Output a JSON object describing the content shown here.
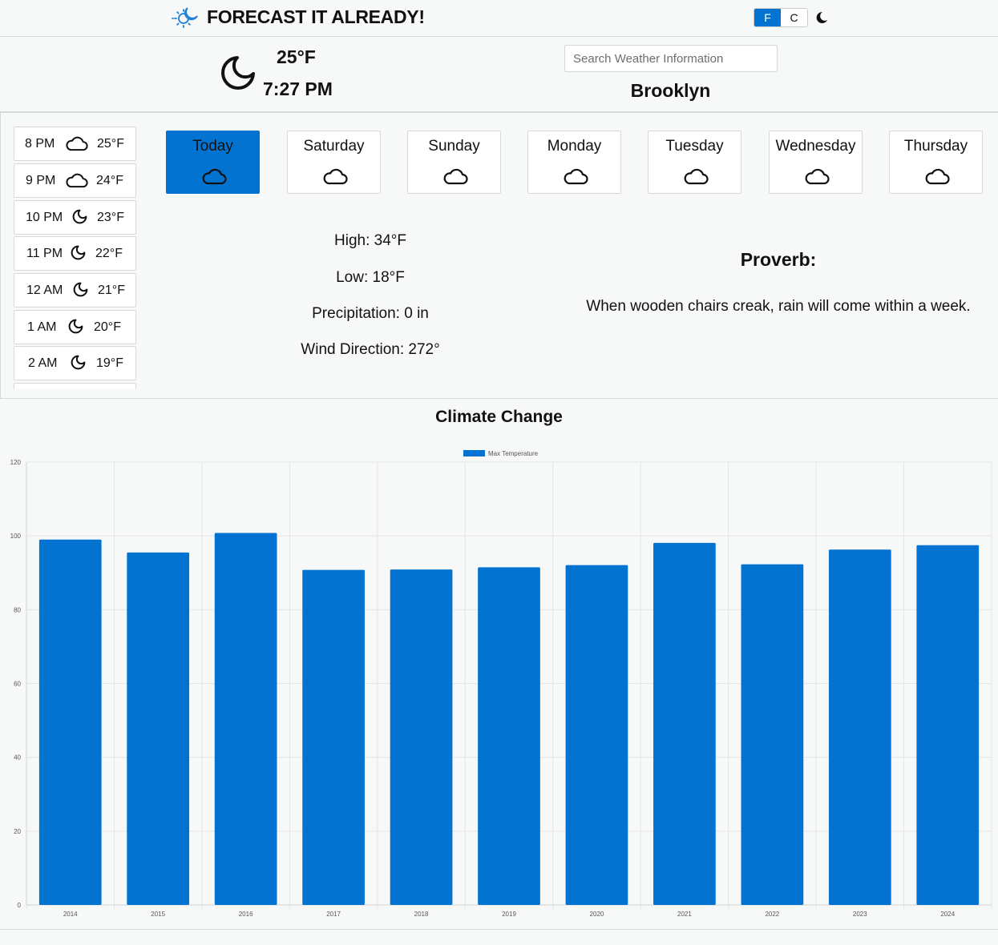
{
  "header": {
    "title": "FORECAST IT ALREADY!",
    "logo_icon": "sun-moon-icon",
    "units": [
      "F",
      "C"
    ],
    "active_unit": "F",
    "theme_icon": "moon-icon"
  },
  "current": {
    "icon": "moon-icon",
    "temp": "25°F",
    "time": "7:27 PM",
    "city": "Brooklyn"
  },
  "search": {
    "placeholder": "Search Weather Information"
  },
  "hourly": [
    {
      "time": "8 PM",
      "icon": "cloud-icon",
      "temp": "25°F"
    },
    {
      "time": "9 PM",
      "icon": "cloud-icon",
      "temp": "24°F"
    },
    {
      "time": "10 PM",
      "icon": "moon-icon",
      "temp": "23°F"
    },
    {
      "time": "11 PM",
      "icon": "moon-icon",
      "temp": "22°F"
    },
    {
      "time": "12 AM",
      "icon": "moon-icon",
      "temp": "21°F"
    },
    {
      "time": "1 AM",
      "icon": "moon-icon",
      "temp": "20°F"
    },
    {
      "time": "2 AM",
      "icon": "moon-icon",
      "temp": "19°F"
    }
  ],
  "days": [
    {
      "label": "Today",
      "icon": "cloud-icon"
    },
    {
      "label": "Saturday",
      "icon": "cloud-icon"
    },
    {
      "label": "Sunday",
      "icon": "cloud-icon"
    },
    {
      "label": "Monday",
      "icon": "cloud-icon"
    },
    {
      "label": "Tuesday",
      "icon": "cloud-icon"
    },
    {
      "label": "Wednesday",
      "icon": "cloud-icon"
    },
    {
      "label": "Thursday",
      "icon": "cloud-icon"
    }
  ],
  "details": {
    "high": "High: 34°F",
    "low": "Low: 18°F",
    "precipitation": "Precipitation: 0 in",
    "wind": "Wind Direction: 272°"
  },
  "proverb": {
    "title": "Proverb:",
    "text": "When wooden chairs creak, rain will come within a week."
  },
  "colors": {
    "accent": "#0273d0",
    "border": "#d6d8da",
    "background": "#f7f8f8"
  },
  "chart_section": {
    "title": "Climate Change"
  },
  "chart_data": {
    "type": "bar",
    "categories": [
      "2014",
      "2015",
      "2016",
      "2017",
      "2018",
      "2019",
      "2020",
      "2021",
      "2022",
      "2023",
      "2024"
    ],
    "series": [
      {
        "name": "Max Temperature",
        "values": [
          99,
          95.5,
          100.8,
          90.8,
          90.9,
          91.5,
          92.1,
          98.1,
          92.3,
          96.3,
          97.5
        ]
      }
    ],
    "ylim": [
      0,
      120
    ],
    "yticks": [
      "0",
      "20",
      "40",
      "60",
      "80",
      "100",
      "120"
    ],
    "legend": "top-center",
    "grid": true
  }
}
